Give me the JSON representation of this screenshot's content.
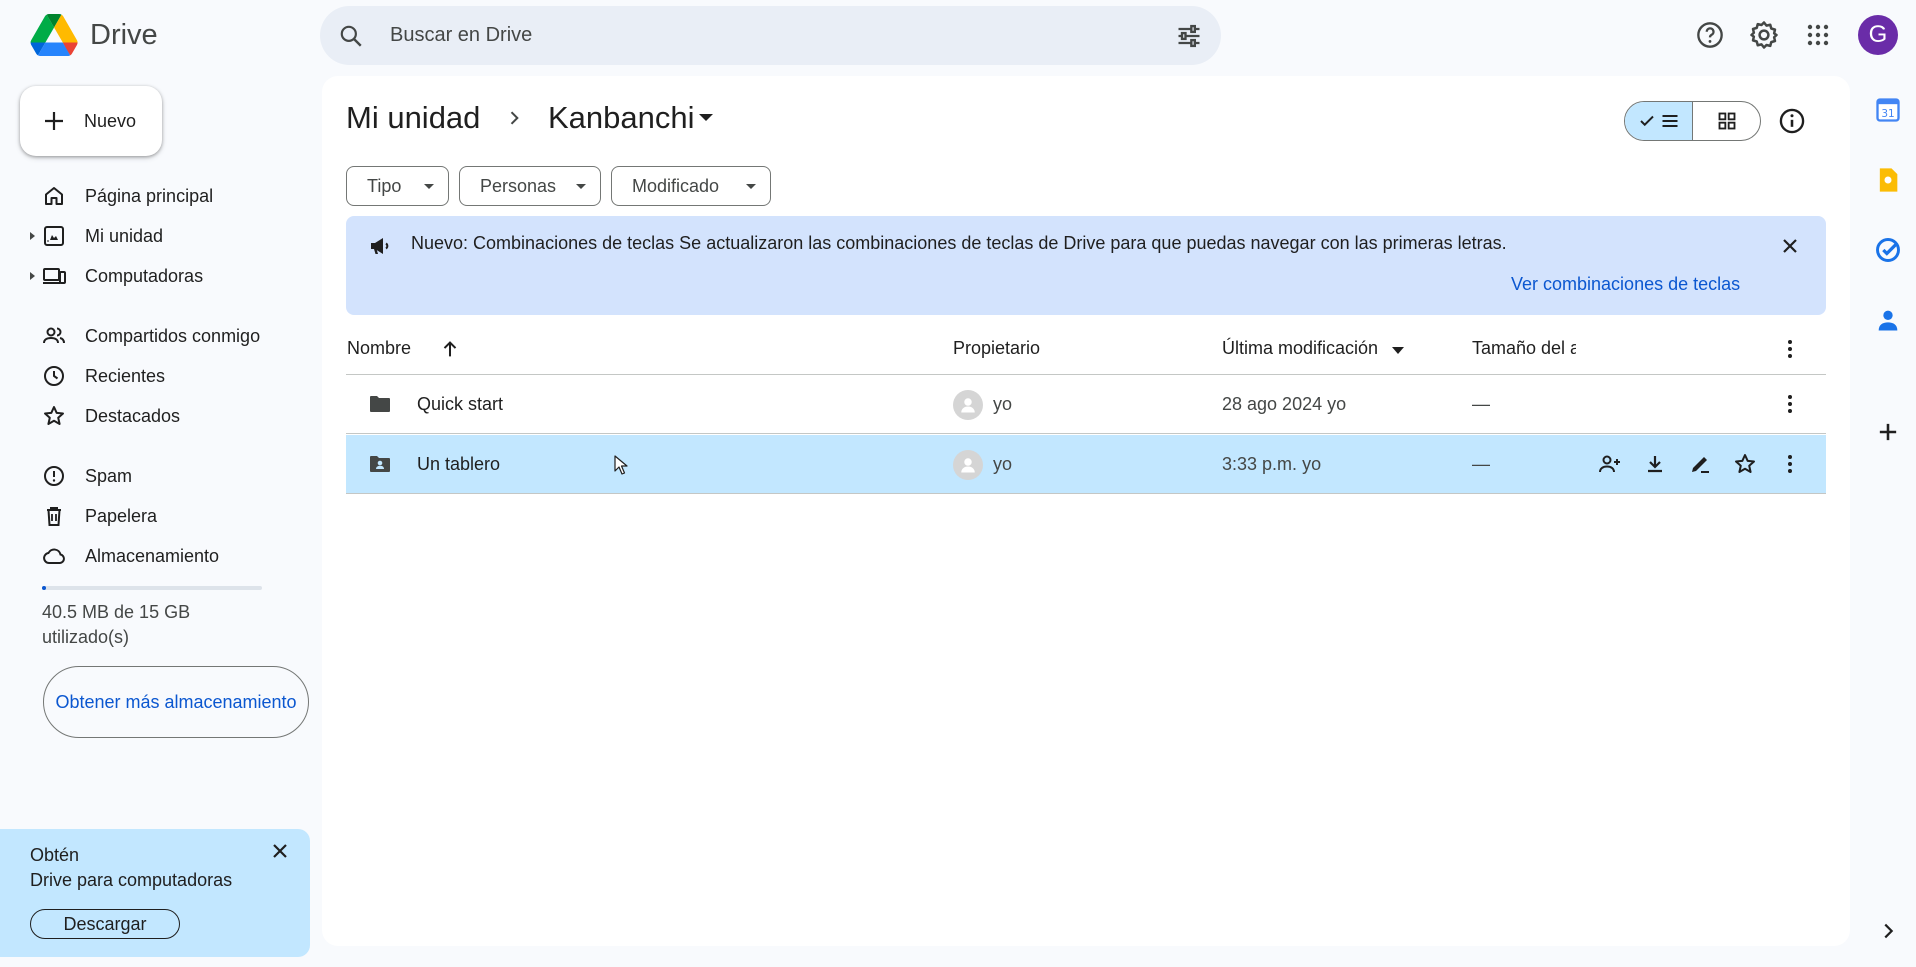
{
  "app": {
    "name": "Drive"
  },
  "search": {
    "placeholder": "Buscar en Drive"
  },
  "user": {
    "initial": "G"
  },
  "new_button": {
    "label": "Nuevo"
  },
  "nav": [
    {
      "label": "Página principal",
      "icon": "home-icon"
    },
    {
      "label": "Mi unidad",
      "icon": "my-drive-icon"
    },
    {
      "label": "Computadoras",
      "icon": "computer-icon"
    },
    {
      "label": "Compartidos conmigo",
      "icon": "people-icon"
    },
    {
      "label": "Recientes",
      "icon": "clock-icon"
    },
    {
      "label": "Destacados",
      "icon": "star-icon"
    },
    {
      "label": "Spam",
      "icon": "spam-icon"
    },
    {
      "label": "Papelera",
      "icon": "trash-icon"
    },
    {
      "label": "Almacenamiento",
      "icon": "cloud-icon"
    }
  ],
  "storage": {
    "text": "40.5 MB de 15 GB utilizado(s)",
    "used_fraction": 0.0027,
    "button": "Obtener más almacenamiento"
  },
  "promo": {
    "line1": "Obtén",
    "line2": "Drive para computadoras",
    "button": "Descargar"
  },
  "breadcrumb": {
    "root": "Mi unidad",
    "current": "Kanbanchi"
  },
  "filters": [
    {
      "label": "Tipo"
    },
    {
      "label": "Personas"
    },
    {
      "label": "Modificado"
    }
  ],
  "banner": {
    "title": "Nuevo: Combinaciones de teclas",
    "text": "Se actualizaron las combinaciones de teclas de Drive para que puedas navegar con las primeras letras.",
    "link": "Ver combinaciones de teclas"
  },
  "table": {
    "columns": {
      "name": "Nombre",
      "owner": "Propietario",
      "modified": "Última modificación",
      "size": "Tamaño del a"
    },
    "rows": [
      {
        "name": "Quick start",
        "owner": "yo",
        "modified": "28 ago 2024",
        "modified_by": "yo",
        "size": "—",
        "type": "folder",
        "selected": false
      },
      {
        "name": "Un tablero",
        "owner": "yo",
        "modified": "3:33 p.m.",
        "modified_by": "yo",
        "size": "—",
        "type": "shared-folder",
        "selected": true
      }
    ]
  },
  "colors": {
    "accent": "#0b57d0",
    "selected": "#c2e7ff",
    "banner": "#d3e3fd",
    "background": "#f8fafd"
  }
}
